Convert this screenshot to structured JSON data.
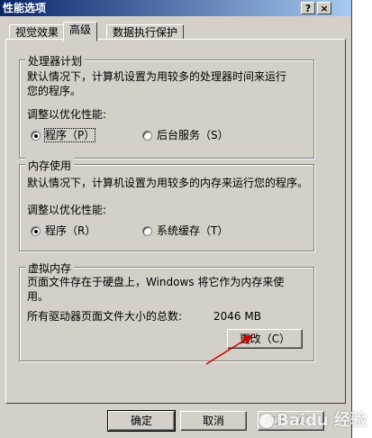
{
  "window": {
    "title": "性能选项",
    "help_button": "?",
    "close_button": "×"
  },
  "tabs": [
    {
      "label": "视觉效果",
      "active": false
    },
    {
      "label": "高级",
      "active": true
    },
    {
      "label": "数据执行保护",
      "active": false
    }
  ],
  "processor": {
    "legend": "处理器计划",
    "desc_line1": "默认情况下，计算机设置为用较多的处理器时间来运行",
    "desc_line2": "您的程序。",
    "adjust_label": "调整以优化性能:",
    "option_programs": "程序（P）",
    "option_background": "后台服务（S）",
    "selected": "programs"
  },
  "memory": {
    "legend": "内存使用",
    "desc_line1": "默认情况下，计算机设置为用较多的内存来运行您的程序。",
    "adjust_label": "调整以优化性能:",
    "option_programs": "程序（R）",
    "option_cache": "系统缓存（T）",
    "selected": "programs"
  },
  "virtual_memory": {
    "legend": "虚拟内存",
    "desc_line1": "页面文件存在于硬盘上，Windows 将它作为内存来使",
    "desc_line2": "用。",
    "total_label": "所有驱动器页面文件大小的总数:",
    "total_value": "2046 MB",
    "change_button": "更改（C）"
  },
  "footer": {
    "ok": "确定",
    "cancel": "取消",
    "apply": "应用（A）"
  },
  "watermark": "Baidu 经验",
  "colors": {
    "dialog_face": "#d4d0c8",
    "title_gradient_start": "#0a246a",
    "annotation_arrow": "#cc0000"
  }
}
